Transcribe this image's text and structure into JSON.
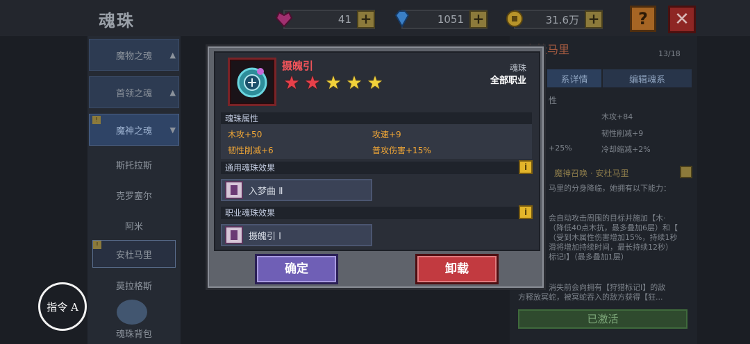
{
  "header": {
    "title": "魂珠",
    "currencies": [
      {
        "icon": "heart-gem-icon",
        "value": "41",
        "color": "#b0307a"
      },
      {
        "icon": "diamond-icon",
        "value": "1051",
        "color": "#3a8ad6"
      },
      {
        "icon": "gold-coin-icon",
        "value": "31.6万",
        "color": "#c9a227"
      }
    ],
    "help_label": "?",
    "close_label": "✕"
  },
  "sidebar": {
    "items": [
      {
        "label": "魔物之魂",
        "kind": "category"
      },
      {
        "label": "首领之魂",
        "kind": "category"
      },
      {
        "label": "魔神之魂",
        "kind": "category-active"
      },
      {
        "label": "斯托拉斯",
        "kind": "entry"
      },
      {
        "label": "克罗塞尔",
        "kind": "entry"
      },
      {
        "label": "阿米",
        "kind": "entry"
      },
      {
        "label": "安杜马里",
        "kind": "entry-selected"
      },
      {
        "label": "莫拉格斯",
        "kind": "entry"
      }
    ],
    "bag_label": "魂珠背包"
  },
  "right_panel": {
    "title_fragment": "安杜马里",
    "progress": "13/18",
    "tabs": [
      "系详情",
      "编辑魂系"
    ],
    "section_fragment": "性",
    "stats": [
      "木攻+84",
      "韧性削减+9",
      "+25%",
      "冷却缩减+2%"
    ],
    "skill_title": "魔神召唤 · 安杜马里",
    "desc_lines": [
      "马里的分身降临，她拥有以下能力：",
      "会自动攻击周围的目标并施加【木·",
      "（降低40点木抗，最多叠加6层）和【",
      "（受到木属性伤害增加15%，持续1秒",
      "滑将增加持续时间，最长持续12秒）",
      "标记Ⅰ】（最多叠加1层）",
      "消失前会向拥有【狩猎标记Ⅰ】的敌",
      "方释放冥蛇，被冥蛇吞入的敌方获得【狂..."
    ],
    "activated_label": "已激活"
  },
  "command_button": "指令 A",
  "modal": {
    "item_name": "摄魄引",
    "stars": [
      "red",
      "red",
      "gold",
      "gold",
      "gold"
    ],
    "type_label": "魂珠",
    "class_label": "全部职业",
    "attr_section_title": "魂珠属性",
    "attributes": [
      "木攻+50",
      "攻速+9",
      "韧性削减+6",
      "普攻伤害+15%"
    ],
    "common_section_title": "通用魂珠效果",
    "common_effect": "入梦曲 Ⅱ",
    "class_section_title": "职业魂珠效果",
    "class_effect": "摄魄引 Ⅰ",
    "confirm_label": "确定",
    "unload_label": "卸载"
  }
}
